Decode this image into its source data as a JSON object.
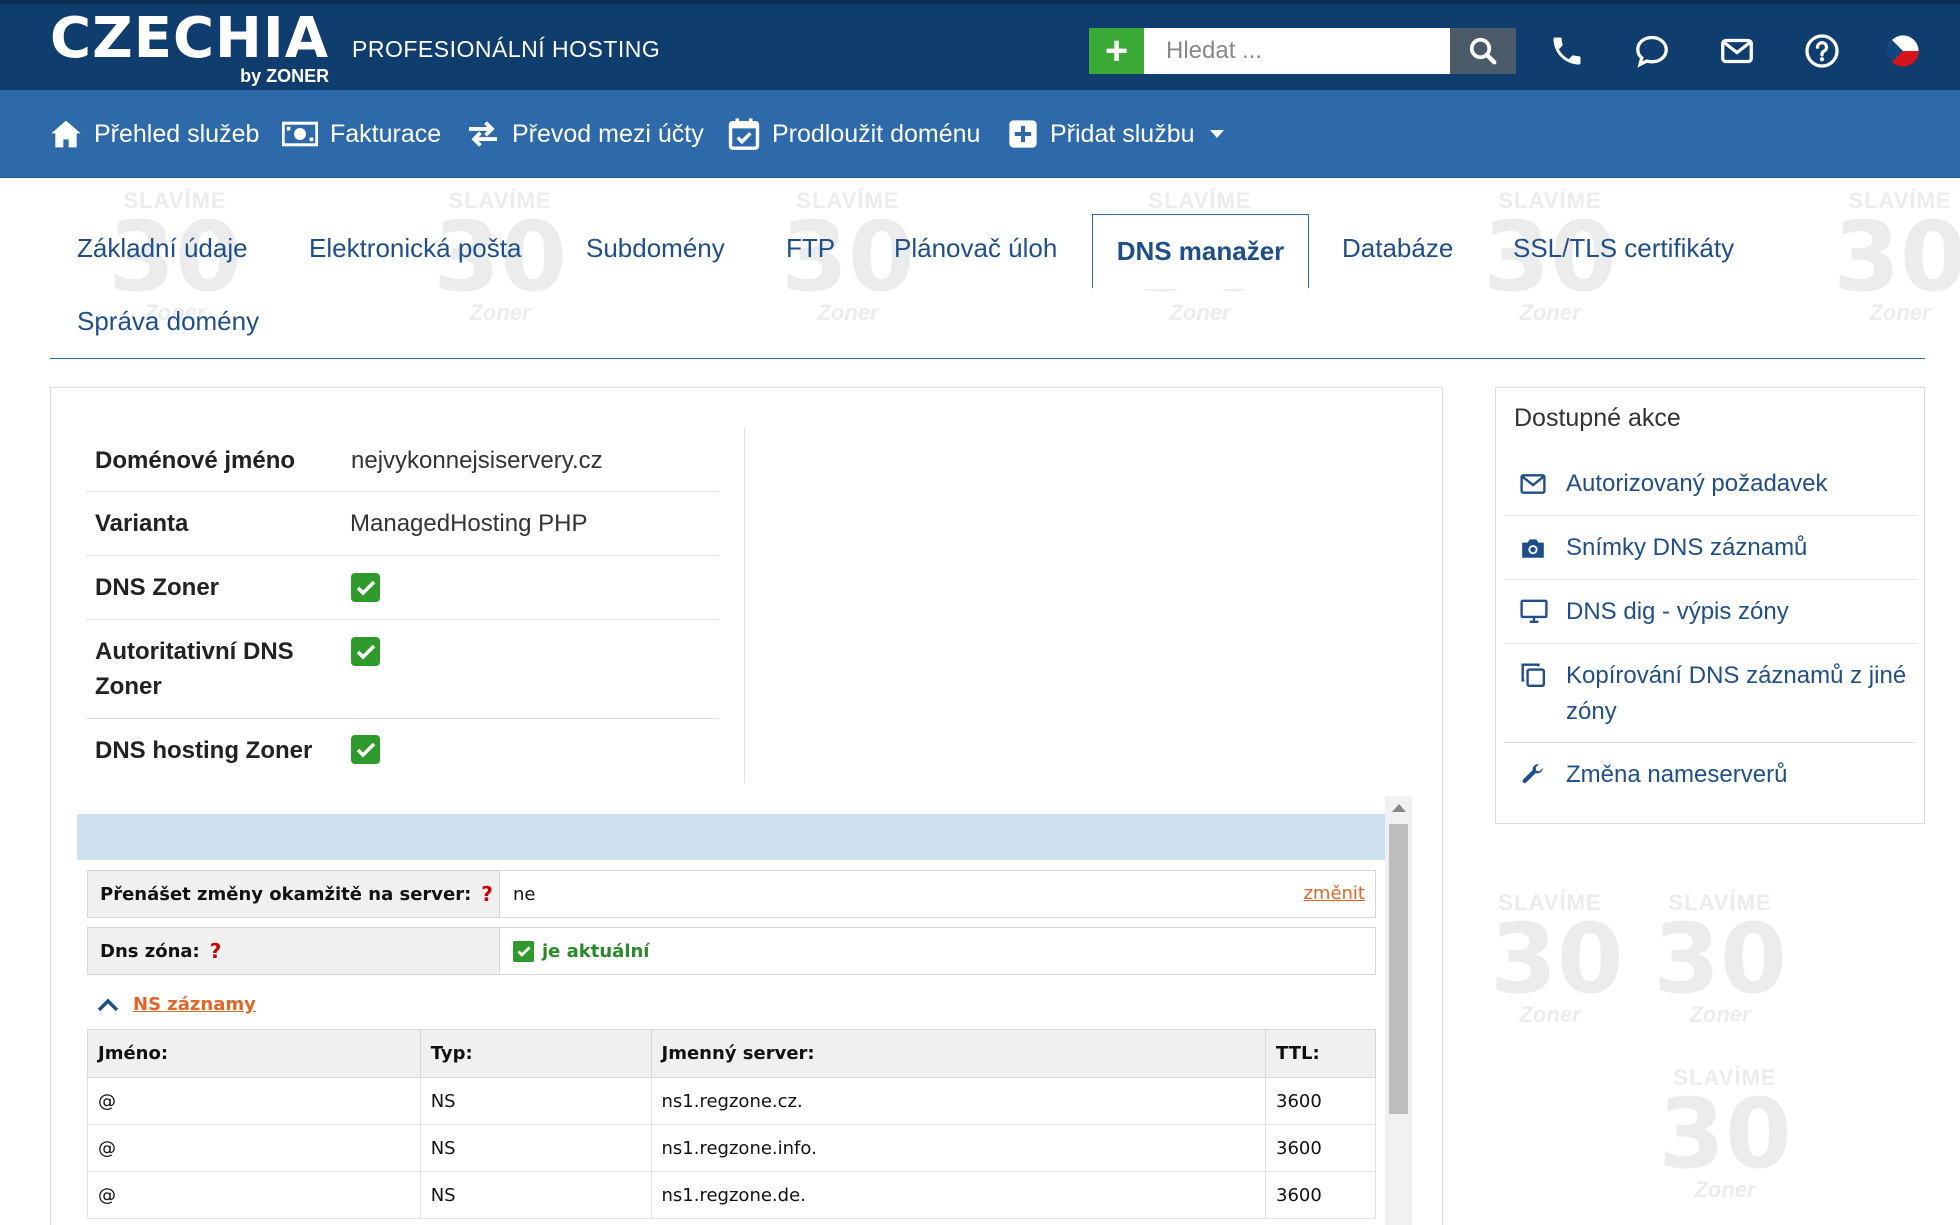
{
  "header": {
    "logo_main": "CZECHIA",
    "logo_sub": "by ZONER",
    "tagline": "PROFESIONÁLNÍ HOSTING",
    "add_label": "+",
    "search_placeholder": "Hledat ..."
  },
  "nav": {
    "items": [
      {
        "label": "Přehled služeb",
        "icon": "home-icon"
      },
      {
        "label": "Fakturace",
        "icon": "billing-icon"
      },
      {
        "label": "Převod mezi účty",
        "icon": "transfer-icon"
      },
      {
        "label": "Prodloužit doménu",
        "icon": "calendar-check-icon"
      },
      {
        "label": "Přidat službu",
        "icon": "plus-square-icon"
      }
    ]
  },
  "watermark": {
    "line1": "SLAVÍME",
    "line2": "30",
    "line3": "Zoner"
  },
  "tabs": [
    {
      "label": "Základní údaje"
    },
    {
      "label": "Elektronická pošta"
    },
    {
      "label": "Subdomény"
    },
    {
      "label": "FTP"
    },
    {
      "label": "Plánovač úloh"
    },
    {
      "label": "DNS manažer",
      "active": true
    },
    {
      "label": "Databáze"
    },
    {
      "label": "SSL/TLS certifikáty"
    },
    {
      "label": "Správa domény"
    }
  ],
  "info": {
    "domain_label": "Doménové jméno",
    "domain_value": "nejvykonnejsiservery.cz",
    "variant_label": "Varianta",
    "variant_value": "ManagedHosting PHP",
    "dns_zoner_label": "DNS Zoner",
    "auth_dns_label_1": "Autoritativní DNS",
    "auth_dns_label_2": "Zoner",
    "dns_hosting_label": "DNS hosting Zoner"
  },
  "dns_manager": {
    "transfer_label": "Přenášet změny okamžitě na server:",
    "transfer_value": "ne",
    "change_link": "změnit",
    "zone_label": "Dns zóna:",
    "zone_status": "je aktuální",
    "qmark": "?",
    "ns_toggle": "NS záznamy",
    "columns": [
      "Jméno:",
      "Typ:",
      "Jmenný server:",
      "TTL:"
    ],
    "rows": [
      [
        "@",
        "NS",
        "ns1.regzone.cz.",
        "3600"
      ],
      [
        "@",
        "NS",
        "ns1.regzone.info.",
        "3600"
      ],
      [
        "@",
        "NS",
        "ns1.regzone.de.",
        "3600"
      ]
    ]
  },
  "actions": {
    "title": "Dostupné akce",
    "items": [
      {
        "label": "Autorizovaný požadavek",
        "icon": "envelope-icon"
      },
      {
        "label": "Snímky DNS záznamů",
        "icon": "camera-icon"
      },
      {
        "label": "DNS dig - výpis zóny",
        "icon": "monitor-icon"
      },
      {
        "label": "Kopírování DNS záznamů z jiné zóny",
        "icon": "copy-icon"
      },
      {
        "label": "Změna nameserverů",
        "icon": "wrench-icon"
      }
    ]
  },
  "colors": {
    "header": "#0f3d6e",
    "nav": "#2e6aaa",
    "link": "#1f4f8a",
    "check": "#2e9a2c",
    "accent_orange": "#e0662a"
  }
}
